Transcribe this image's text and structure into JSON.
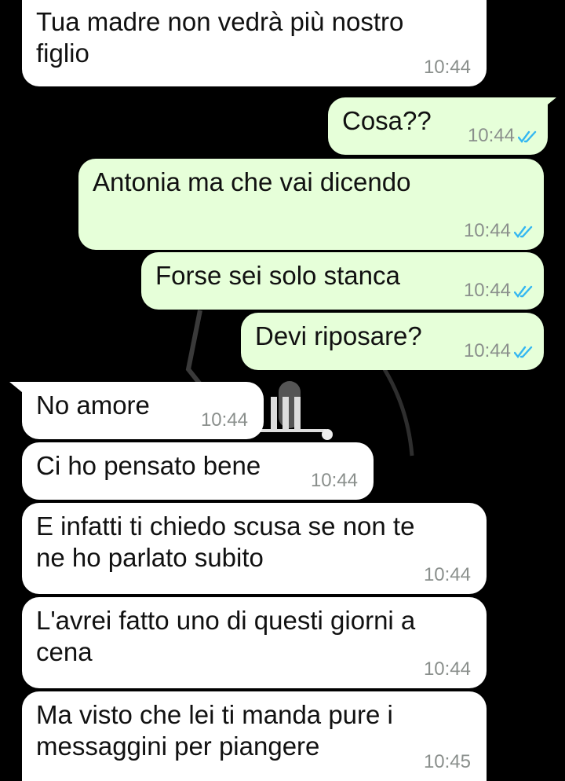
{
  "chat": {
    "messages": [
      {
        "dir": "in",
        "text": "Tua madre non vedrà più nostro\nfiglio",
        "time": "10:44"
      },
      {
        "dir": "out",
        "text": "Cosa??",
        "time": "10:44",
        "status": "read"
      },
      {
        "dir": "out",
        "text": "Antonia ma che vai dicendo",
        "time": "10:44",
        "status": "read"
      },
      {
        "dir": "out",
        "text": "Forse sei solo stanca",
        "time": "10:44",
        "status": "read"
      },
      {
        "dir": "out",
        "text": "Devi riposare?",
        "time": "10:44",
        "status": "read"
      },
      {
        "dir": "in",
        "text": "No amore",
        "time": "10:44"
      },
      {
        "dir": "in",
        "text": "Ci ho pensato bene",
        "time": "10:44"
      },
      {
        "dir": "in",
        "text": "E infatti ti chiedo scusa se non te\nne ho parlato subito",
        "time": "10:44"
      },
      {
        "dir": "in",
        "text": "L'avrei fatto uno di questi giorni a\ncena",
        "time": "10:44"
      },
      {
        "dir": "in",
        "text": "Ma visto che lei ti manda pure i\nmessaggini per piangere",
        "time": "10:45"
      }
    ]
  },
  "colors": {
    "background": "#000000",
    "incoming_bubble": "#ffffff",
    "outgoing_bubble": "#e6ffd9",
    "timestamp": "#8a8f8c",
    "read_ticks": "#34b7f1"
  }
}
